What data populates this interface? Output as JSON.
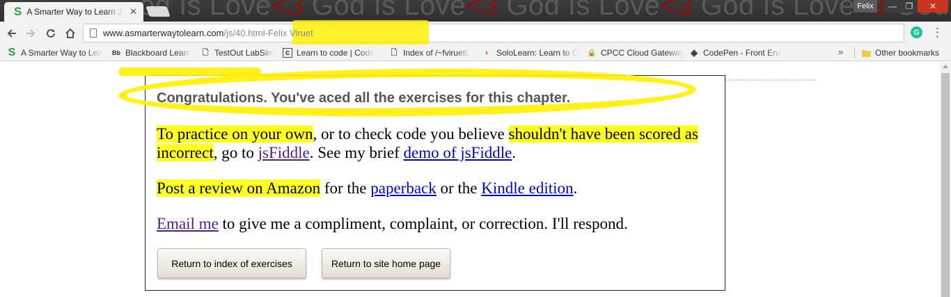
{
  "browser": {
    "tab_title": "A Smarter Way to Learn J",
    "tab_favicon": "S",
    "tab_close": "✕",
    "theme_text_parts": [
      "od Is Love",
      "<3",
      " God Is Love",
      "<3",
      " God Is Love",
      "<3",
      " God Is Love",
      "<3",
      " God"
    ],
    "profile_name": "Felix",
    "window_controls": {
      "minimize": "—",
      "restore": "❐",
      "close": "✕"
    },
    "url_host": "www.asmarterwaytolearn.com",
    "url_path": "/js/40.html-Felix Viruet",
    "bookmarks": [
      {
        "label": "A Smarter Way to Lea",
        "icon": "S",
        "icon_name": "smarter-way-icon",
        "icon_color": "#2e9e3a"
      },
      {
        "label": "Blackboard Learn",
        "icon": "Bb",
        "icon_name": "blackboard-icon",
        "icon_color": "#111111"
      },
      {
        "label": "TestOut LabSim",
        "icon": "🗋",
        "icon_name": "page-icon",
        "icon_color": "#555555"
      },
      {
        "label": "Learn to code | Code",
        "icon": "c",
        "icon_name": "codecademy-icon",
        "icon_color": "#333333"
      },
      {
        "label": "Index of /~fviruet0",
        "icon": "🗋",
        "icon_name": "page-icon",
        "icon_color": "#555555"
      },
      {
        "label": "SoloLearn: Learn to C",
        "icon": "◐",
        "icon_name": "sololearn-icon",
        "icon_color": "#e0563a"
      },
      {
        "label": "CPCC Cloud Gateway",
        "icon": "🔒",
        "icon_name": "lock-icon",
        "icon_color": "#2255aa"
      },
      {
        "label": "CodePen - Front End",
        "icon": "◈",
        "icon_name": "codepen-icon",
        "icon_color": "#222222"
      }
    ],
    "bookmarks_overflow": "»",
    "other_bookmarks": "Other bookmarks"
  },
  "page": {
    "heading": "Congratulations. You've aced all the exercises for this chapter.",
    "p1": {
      "hl1": "To practice on your own",
      "t1": ", or to check code you believe ",
      "hl2": "shouldn't have been scored as incorrect",
      "t2": ", go to ",
      "link1": "jsFiddle",
      "t3": ". See my brief ",
      "link2": "demo of jsFiddle",
      "t4": "."
    },
    "p2": {
      "hl1": "Post a review on Amazon",
      "t1": " for the ",
      "link1": "paperback",
      "t2": " or the ",
      "link2": "Kindle edition",
      "t3": "."
    },
    "p3": {
      "link1": "Email me",
      "t1": " to give me a compliment, complaint, or correction. I'll respond."
    },
    "buttons": {
      "index": "Return to index of exercises",
      "home": "Return to site home page"
    }
  },
  "colors": {
    "highlight": "#ffff22",
    "marker": "#fff000",
    "link": "#0000cc",
    "visited_link": "#551a8b"
  }
}
